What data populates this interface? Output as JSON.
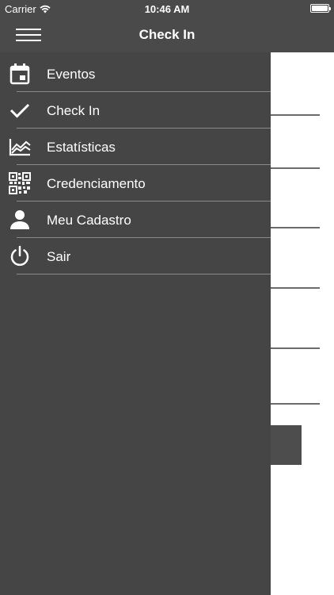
{
  "status_bar": {
    "carrier": "Carrier",
    "time": "10:46 AM"
  },
  "nav": {
    "title": "Check In",
    "menu_icon": "hamburger-icon"
  },
  "drawer": {
    "items": [
      {
        "label": "Eventos",
        "icon": "calendar-icon"
      },
      {
        "label": "Check In",
        "icon": "checkmark-icon"
      },
      {
        "label": "Estatísticas",
        "icon": "line-chart-icon"
      },
      {
        "label": "Credenciamento",
        "icon": "qr-code-icon"
      },
      {
        "label": "Meu Cadastro",
        "icon": "person-icon"
      },
      {
        "label": "Sair",
        "icon": "power-icon"
      }
    ]
  },
  "colors": {
    "bar_background": "#4a4a4a",
    "drawer_background": "#454545",
    "text": "#ffffff",
    "divider": "#8a8a8a"
  }
}
